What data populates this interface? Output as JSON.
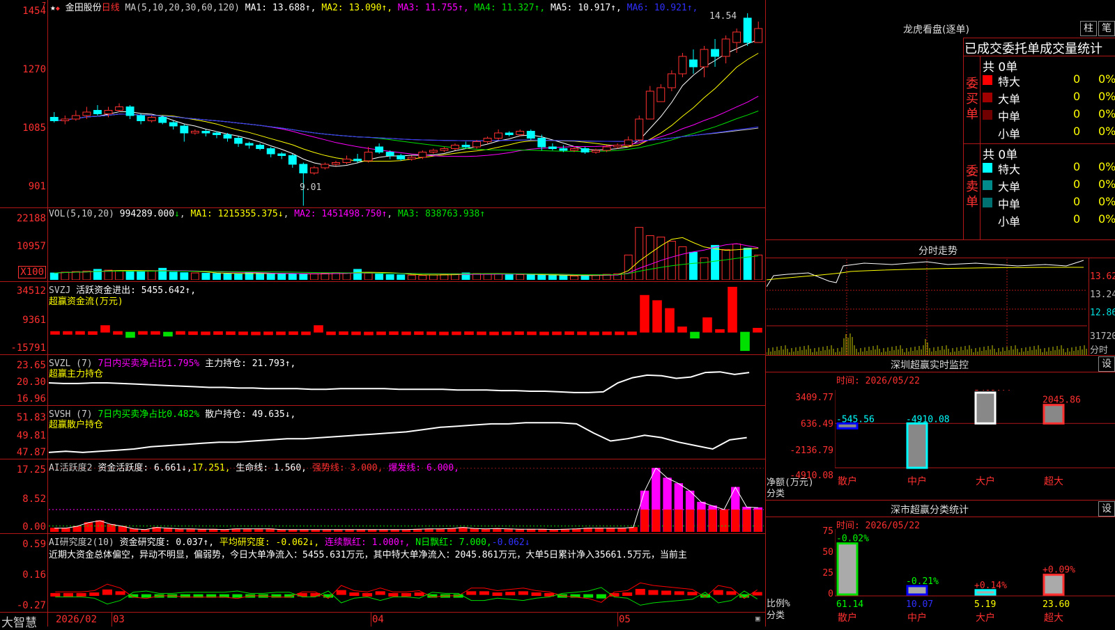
{
  "header": {
    "stock_name": "金田股份",
    "period": "日线",
    "ma_label": "MA(5,10,20,30,60,120)",
    "ma": [
      {
        "k": "MA1:",
        "v": "13.688",
        "a": "↑",
        "c": "#ffffff"
      },
      {
        "k": "MA2:",
        "v": "13.090",
        "a": "↑",
        "c": "#ffff00"
      },
      {
        "k": "MA3:",
        "v": "11.755",
        "a": "↑",
        "c": "#ff00ff"
      },
      {
        "k": "MA4:",
        "v": "11.327",
        "a": "↑",
        "c": "#00e000"
      },
      {
        "k": "MA5:",
        "v": "10.917",
        "a": "↑",
        "c": "#ffffff"
      },
      {
        "k": "MA6:",
        "v": "10.921",
        "a": "↑",
        "c": "#3030ff"
      }
    ],
    "high_label": "14.54",
    "low_label": "9.01"
  },
  "price_axis": [
    "1454",
    "1270",
    "1085",
    "901"
  ],
  "vol": {
    "label": "VOL(5,10,20)",
    "value": "994289.000",
    "arrow": "↓",
    "ma1": "MA1: 1215355.375↓",
    "ma2": "MA2: 1451498.750↑",
    "ma3": "MA3: 838763.938↑",
    "axis": [
      "22188",
      "10957"
    ],
    "unit": "X100"
  },
  "svzj": {
    "label": "SVZJ",
    "text": "活跃资金进出: 5455.642↑,",
    "sub": "超赢资金流(万元)",
    "axis": [
      "34512",
      "9361",
      "-15791"
    ]
  },
  "svzl": {
    "label": "SVZL (7)",
    "text1": "7日内买卖净占比1.795%",
    "text2": "主力持仓: 21.793↑,",
    "sub": "超赢主力持仓",
    "axis": [
      "23.65",
      "20.30",
      "16.96"
    ]
  },
  "svsh": {
    "label": "SVSH (7)",
    "text1": "7日内买卖净占比0.482%",
    "text2": "散户持仓: 49.635↓,",
    "sub": "超赢散户持仓",
    "axis": [
      "51.83",
      "49.81",
      "47.87"
    ]
  },
  "ai1": {
    "label": "AI活跃度2",
    "t1": "资金活跃度: 6.661↓,",
    "t2": "17.251,",
    "t3": "生命线: 1.560,",
    "t4": "强势线: 3.000,",
    "t5": "爆发线: 6.000,",
    "axis": [
      "17.25",
      "8.52",
      "0.00"
    ]
  },
  "ai2": {
    "label": "AI研究度2(10)",
    "t1": "资金研究度: 0.037↑,",
    "t2": "平均研究度: -0.062↓,",
    "t3": "连续飘红: 1.000↑,",
    "t4": "N日飘红: 7.000,",
    "t5": "-0.062↓",
    "desc": "近期大资金总体偏空，异动不明显，偏弱势，今日大单净流入：5455.631万元，其中特大单净流入：2045.861万元，大单5日累计净入35661.5万元，当前主",
    "axis": [
      "0.59",
      "0.16",
      "-0.27"
    ]
  },
  "footer": {
    "brand": "大智慧",
    "dates": [
      "2026/02",
      "03",
      "04",
      "05"
    ]
  },
  "dragon": {
    "title": "龙虎看盘(逐单)",
    "btn1": "柱",
    "btn2": "笔",
    "tabs": "已成交委托单成交量统计",
    "buy_label": "委买单",
    "sell_label": "委卖单",
    "buy_count": "共 0单",
    "sell_count": "共 0单",
    "buy_rows": [
      {
        "name": "特大",
        "c": "#ff0000",
        "v": "0",
        "p": "0%"
      },
      {
        "name": "大单",
        "c": "#a00000",
        "v": "0",
        "p": "0%"
      },
      {
        "name": "中单",
        "c": "#700000",
        "v": "0",
        "p": "0%"
      },
      {
        "name": "小单",
        "c": "#000000",
        "v": "0",
        "p": "0%"
      }
    ],
    "sell_rows": [
      {
        "name": "特大",
        "c": "#00ffff",
        "v": "0",
        "p": "0%"
      },
      {
        "name": "大单",
        "c": "#008a8a",
        "v": "0",
        "p": "0%"
      },
      {
        "name": "中单",
        "c": "#007070",
        "v": "0",
        "p": "0%"
      },
      {
        "name": "小单",
        "c": "#000000",
        "v": "0",
        "p": "0%"
      }
    ]
  },
  "intraday": {
    "title": "分时走势",
    "axis": [
      "13.62",
      "13.24",
      "12.86"
    ],
    "vol_axis": "31720",
    "unit": "分时"
  },
  "sz_monitor": {
    "title": "深圳超赢实时监控",
    "btn": "设",
    "time": "时间: 2026/05/22",
    "axis": [
      "3409.77",
      "636.49",
      "-2136.79",
      "-4910.08"
    ],
    "ylabel": "净额(万元)",
    "xlabel": "分类",
    "values": [
      {
        "name": "散户",
        "v": "-545.56"
      },
      {
        "name": "中户",
        "v": "-4910.08"
      },
      {
        "name": "大户",
        "v": "3409.77"
      },
      {
        "name": "超大",
        "v": "2045.86"
      }
    ]
  },
  "sz_stats": {
    "title": "深市超赢分类统计",
    "btn": "设",
    "time": "时间: 2026/05/22",
    "axis": [
      "75",
      "50",
      "25",
      "0"
    ],
    "ylabel": "比例%",
    "xlabel": "分类",
    "values": [
      {
        "name": "散户",
        "v": "61.14",
        "d": "-0.02%"
      },
      {
        "name": "中户",
        "v": "10.07",
        "d": "-0.21%"
      },
      {
        "name": "大户",
        "v": "5.19",
        "d": "+0.14%"
      },
      {
        "name": "超大",
        "v": "23.60",
        "d": "+0.09%"
      }
    ]
  },
  "chart_data": [
    {
      "type": "candlestick",
      "title": "金田股份 日线",
      "ylim": [
        9.0,
        14.6
      ],
      "candles": [
        [
          11.55,
          11.45,
          11.7,
          11.4
        ],
        [
          11.45,
          11.5,
          11.6,
          11.35
        ],
        [
          11.5,
          11.6,
          11.75,
          11.45
        ],
        [
          11.6,
          11.7,
          11.85,
          11.5
        ],
        [
          11.75,
          11.65,
          11.9,
          11.6
        ],
        [
          11.65,
          11.75,
          11.85,
          11.55
        ],
        [
          11.75,
          11.85,
          11.95,
          11.7
        ],
        [
          11.85,
          11.6,
          11.9,
          11.5
        ],
        [
          11.6,
          11.45,
          11.65,
          11.35
        ],
        [
          11.45,
          11.55,
          11.6,
          11.4
        ],
        [
          11.55,
          11.4,
          11.6,
          11.35
        ],
        [
          11.4,
          11.3,
          11.45,
          11.2
        ],
        [
          11.3,
          11.1,
          11.35,
          10.85
        ],
        [
          11.1,
          11.15,
          11.2,
          11.05
        ],
        [
          11.15,
          11.1,
          11.2,
          11.0
        ],
        [
          11.1,
          11.05,
          11.15,
          10.95
        ],
        [
          11.05,
          10.95,
          11.1,
          10.85
        ],
        [
          10.95,
          10.8,
          11.0,
          10.7
        ],
        [
          10.8,
          10.75,
          10.85,
          10.65
        ],
        [
          10.75,
          10.65,
          10.8,
          10.6
        ],
        [
          10.65,
          10.5,
          10.7,
          10.4
        ],
        [
          10.5,
          10.45,
          10.55,
          10.35
        ],
        [
          10.45,
          10.2,
          10.5,
          10.1
        ],
        [
          10.2,
          9.95,
          10.25,
          9.01
        ],
        [
          9.95,
          10.1,
          10.15,
          9.9
        ],
        [
          10.1,
          10.2,
          10.25,
          10.05
        ],
        [
          10.2,
          10.25,
          10.3,
          10.15
        ],
        [
          10.25,
          10.35,
          10.45,
          10.2
        ],
        [
          10.35,
          10.3,
          10.5,
          10.25
        ],
        [
          10.3,
          10.55,
          10.7,
          10.25
        ],
        [
          10.7,
          10.55,
          10.8,
          10.5
        ],
        [
          10.55,
          10.45,
          10.6,
          10.35
        ],
        [
          10.45,
          10.35,
          10.5,
          10.3
        ],
        [
          10.35,
          10.4,
          10.45,
          10.3
        ],
        [
          10.4,
          10.55,
          10.6,
          10.35
        ],
        [
          10.55,
          10.6,
          10.65,
          10.5
        ],
        [
          10.6,
          10.65,
          10.7,
          10.55
        ],
        [
          10.65,
          10.75,
          10.8,
          10.6
        ],
        [
          10.75,
          10.7,
          10.85,
          10.65
        ],
        [
          10.7,
          10.85,
          10.9,
          10.65
        ],
        [
          10.85,
          10.95,
          11.0,
          10.8
        ],
        [
          10.95,
          11.1,
          11.2,
          10.9
        ],
        [
          11.1,
          11.05,
          11.15,
          11.0
        ],
        [
          11.05,
          11.15,
          11.2,
          11.0
        ],
        [
          11.15,
          10.95,
          11.2,
          10.9
        ],
        [
          10.95,
          10.7,
          11.05,
          10.6
        ],
        [
          10.7,
          10.65,
          10.8,
          10.6
        ],
        [
          10.65,
          10.6,
          10.75,
          10.55
        ],
        [
          10.6,
          10.65,
          10.7,
          10.55
        ],
        [
          10.65,
          10.55,
          10.7,
          10.5
        ],
        [
          10.55,
          10.6,
          10.65,
          10.5
        ],
        [
          10.6,
          10.7,
          10.75,
          10.55
        ],
        [
          10.7,
          10.75,
          10.8,
          10.65
        ],
        [
          10.75,
          10.9,
          11.0,
          10.7
        ],
        [
          10.9,
          11.5,
          11.6,
          10.85
        ],
        [
          11.5,
          12.3,
          12.45,
          11.8
        ],
        [
          12.0,
          12.4,
          12.5,
          12.1
        ],
        [
          12.4,
          12.8,
          12.9,
          12.3
        ],
        [
          12.8,
          13.3,
          13.4,
          12.7
        ],
        [
          13.2,
          13.0,
          13.5,
          12.8
        ],
        [
          13.0,
          13.5,
          13.6,
          12.7
        ],
        [
          13.5,
          13.3,
          13.8,
          13.0
        ],
        [
          13.3,
          13.8,
          13.9,
          13.1
        ],
        [
          13.7,
          14.0,
          14.1,
          13.4
        ],
        [
          14.4,
          13.7,
          14.54,
          13.6
        ],
        [
          13.7,
          14.1,
          14.3,
          13.8
        ]
      ],
      "ma_lines": [
        "MA1",
        "MA2",
        "MA3",
        "MA4",
        "MA5",
        "MA6"
      ]
    },
    {
      "type": "bar",
      "name": "VOL",
      "ylim": [
        0,
        22188
      ],
      "values": [
        2500,
        2800,
        3000,
        3200,
        3800,
        3500,
        3300,
        3100,
        3000,
        3300,
        4200,
        2800,
        2600,
        2500,
        2400,
        2300,
        2200,
        2100,
        2500,
        2400,
        2300,
        2200,
        2100,
        2000,
        2200,
        2400,
        2600,
        2500,
        3800,
        2400,
        2100,
        1900,
        1800,
        1700,
        1600,
        1800,
        2000,
        2200,
        2500,
        2300,
        2200,
        2100,
        2000,
        1900,
        1800,
        1700,
        1600,
        1500,
        1400,
        1600,
        1800,
        2000,
        2200,
        9000,
        19000,
        16000,
        15500,
        14000,
        12000,
        10000,
        8000,
        12500,
        11000,
        13000,
        11500,
        9000
      ]
    },
    {
      "type": "bar",
      "name": "SVZJ",
      "ylim": [
        -15791,
        34512
      ],
      "values": [
        500,
        500,
        500,
        400,
        5000,
        500,
        -4000,
        500,
        500,
        -3000,
        500,
        300,
        200,
        400,
        300,
        200,
        100,
        200,
        200,
        300,
        200,
        5000,
        200,
        300,
        200,
        100,
        200,
        300,
        200,
        300,
        200,
        100,
        200,
        300,
        200,
        100,
        200,
        300,
        200,
        100,
        200,
        300,
        200,
        100,
        200,
        200,
        200,
        28000,
        24000,
        18000,
        4000,
        -4500,
        11000,
        2000,
        34512,
        -14000,
        3000
      ]
    },
    {
      "type": "line",
      "name": "SVZL",
      "ylim": [
        16.96,
        23.65
      ],
      "values": [
        20.2,
        20.1,
        20.1,
        20.2,
        20.2,
        20.1,
        20.0,
        19.9,
        19.8,
        19.7,
        19.6,
        19.5,
        19.5,
        19.4,
        19.4,
        19.3,
        19.3,
        19.3,
        19.2,
        19.2,
        19.3,
        19.3,
        19.3,
        19.3,
        19.2,
        19.2,
        19.2,
        19.2,
        19.1,
        19.1,
        19.1,
        19.0,
        19.0,
        18.9,
        18.9,
        18.8,
        18.7,
        18.7,
        18.8,
        20.2,
        21.0,
        21.4,
        21.3,
        20.9,
        21.1,
        21.8,
        21.9,
        21.5,
        21.8
      ]
    },
    {
      "type": "line",
      "name": "SVSH",
      "ylim": [
        47.87,
        51.83
      ],
      "values": [
        48.3,
        48.4,
        48.3,
        48.4,
        48.5,
        48.6,
        48.8,
        48.9,
        49.0,
        49.1,
        49.2,
        49.2,
        49.3,
        49.4,
        49.5,
        49.5,
        49.6,
        49.7,
        49.8,
        49.9,
        50.0,
        50.1,
        50.3,
        50.5,
        50.6,
        50.7,
        50.8,
        50.8,
        50.9,
        50.9,
        50.9,
        50.8,
        50.0,
        49.3,
        49.5,
        49.8,
        49.6,
        49.2,
        48.9,
        48.6,
        49.4,
        49.6
      ]
    },
    {
      "type": "bar",
      "name": "AI活跃度2",
      "ylim": [
        0,
        17.25
      ],
      "values": [
        1,
        1,
        1.5,
        2.5,
        3,
        2,
        1.5,
        0.8,
        0.6,
        1.2,
        1,
        0.8,
        0.8,
        0.7,
        0.7,
        0.6,
        0.8,
        0.8,
        0.8,
        0.8,
        0.6,
        0.6,
        0.6,
        0.6,
        0.6,
        0.6,
        0.6,
        0.6,
        0.6,
        0.6,
        0.6,
        0.6,
        0.7,
        0.8,
        0.8,
        0.9,
        1.2,
        0.9,
        0.8,
        0.9,
        0.8,
        0.7,
        0.7,
        0.7,
        0.6,
        0.7,
        0.8,
        1.0,
        1.0,
        1.0,
        1.0,
        1.2,
        11,
        17.25,
        14.5,
        13,
        11,
        8,
        7,
        6,
        12,
        6.661,
        6.5
      ]
    },
    {
      "type": "bar",
      "name": "AI研究度2",
      "ylim": [
        -0.27,
        0.59
      ],
      "values": [
        0.02,
        0.02,
        0.02,
        0.03,
        0.08,
        0.05,
        -0.02,
        -0.03,
        -0.01,
        -0.01,
        -0.02,
        -0.02,
        -0.02,
        -0.02,
        -0.03,
        -0.01,
        -0.01,
        -0.02,
        -0.02,
        0.02,
        0.02,
        -0.03,
        0.07,
        0.03,
        0.02,
        0.05,
        0.02,
        0.02,
        0.03,
        -0.02,
        -0.01,
        -0.01,
        0.05,
        0.05,
        0.03,
        0.04,
        0.05,
        0.03,
        0.02,
        -0.01,
        -0.02,
        -0.03,
        -0.06,
        0.02,
        0.03,
        0.09,
        0.07,
        0.06,
        0.05,
        0.04,
        -0.02,
        0.07,
        0.05,
        -0.03,
        0.037
      ]
    }
  ]
}
